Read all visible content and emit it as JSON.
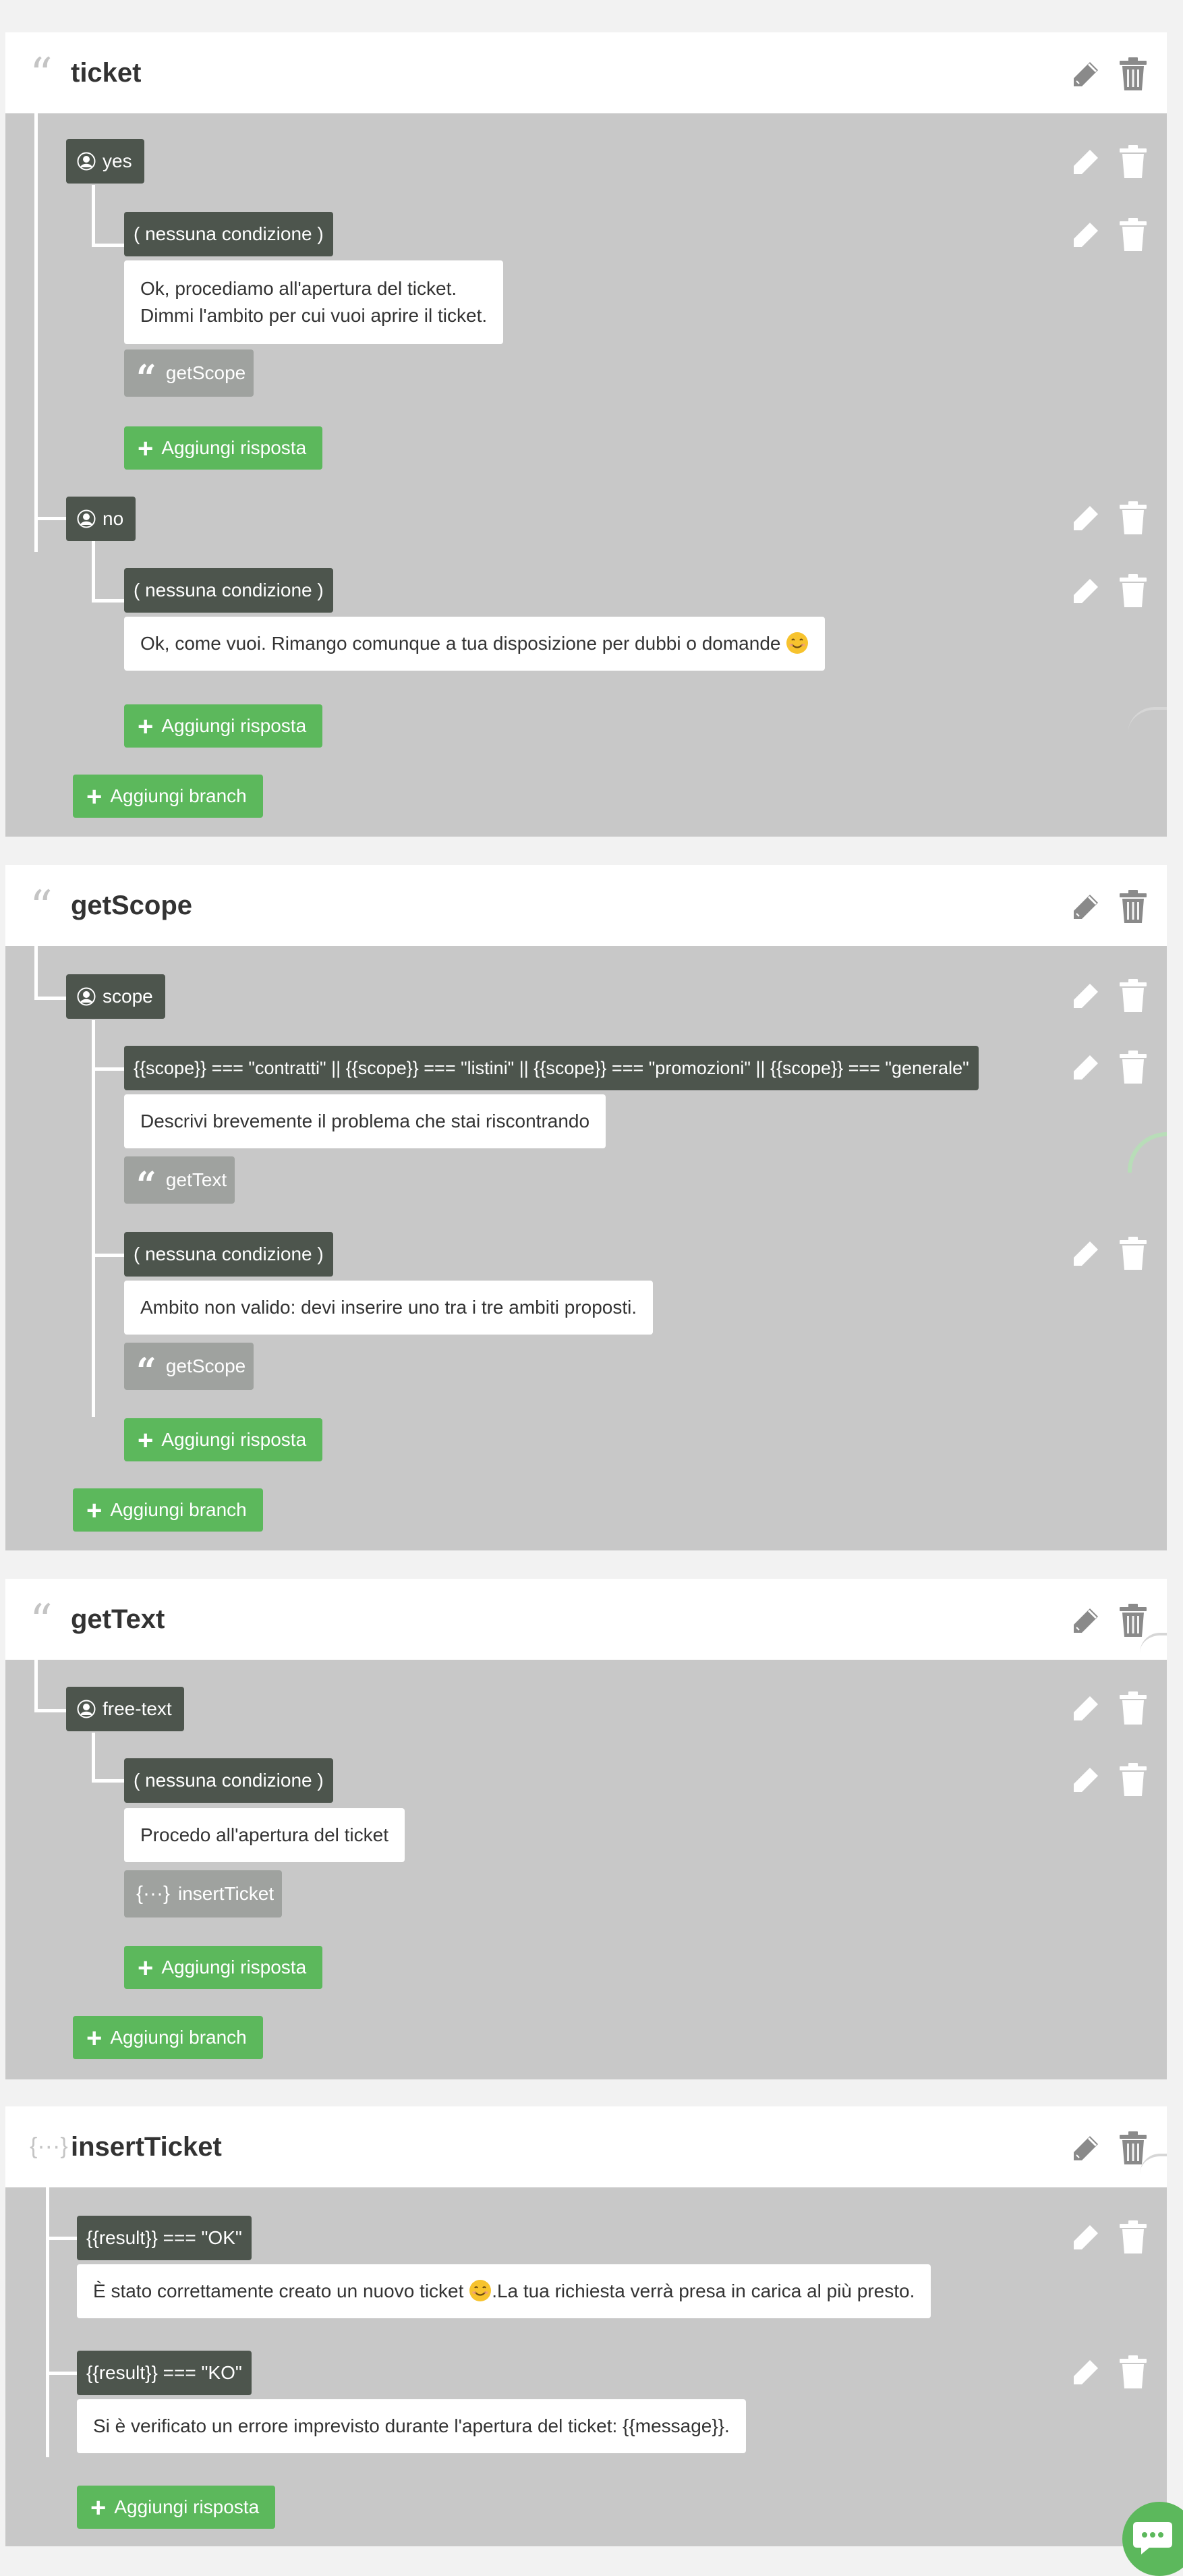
{
  "cards": {
    "ticket": {
      "title": "ticket",
      "icon": "quote-icon",
      "branches": {
        "yes": {
          "label": "yes",
          "cond": "( nessuna condizione )",
          "message": [
            "Ok, procediamo all'apertura del ticket.",
            "Dimmi l'ambito per cui vuoi aprire il ticket."
          ],
          "jump": "getScope",
          "add_reply": "Aggiungi risposta"
        },
        "no": {
          "label": "no",
          "cond": "( nessuna condizione )",
          "message": "Ok, come vuoi. Rimango comunque a tua disposizione per dubbi o domande",
          "add_reply": "Aggiungi risposta"
        }
      },
      "add_branch": "Aggiungi branch"
    },
    "getScope": {
      "title": "getScope",
      "icon": "quote-icon",
      "branch": {
        "label": "scope",
        "cond1": "{{scope}} === \"contratti\" || {{scope}} === \"listini\" || {{scope}} === \"promozioni\" || {{scope}} === \"generale\"",
        "message1": "Descrivi brevemente il problema che stai riscontrando",
        "jump1": "getText",
        "cond2": "( nessuna condizione )",
        "message2": "Ambito non valido: devi inserire uno tra i tre ambiti proposti.",
        "jump2": "getScope",
        "add_reply": "Aggiungi risposta"
      },
      "add_branch": "Aggiungi branch"
    },
    "getText": {
      "title": "getText",
      "icon": "quote-icon",
      "branch": {
        "label": "free-text",
        "cond": "( nessuna condizione )",
        "message": "Procedo all'apertura del ticket",
        "jump": "insertTicket",
        "add_reply": "Aggiungi risposta"
      },
      "add_branch": "Aggiungi branch"
    },
    "insertTicket": {
      "title": "insertTicket",
      "icon": "braces-icon",
      "cond1": "{{result}} === \"OK\"",
      "message1_a": "È stato correttamente creato un nuovo ticket",
      "message1_b": ".La tua richiesta verrà presa in carica al più presto.",
      "cond2": "{{result}} === \"KO\"",
      "message2": "Si è verificato un errore imprevisto durante l'apertura del ticket: {{message}}.",
      "add_reply": "Aggiungi risposta"
    }
  },
  "colors": {
    "page_bg": "#f2f2f2",
    "card_body": "#c8c8c8",
    "chip_dark": "#4d554d",
    "chip_gray": "#9fa29f",
    "accent_green": "#5cb85c"
  },
  "glyphs": {
    "quote": "“",
    "braces": "{···}",
    "plus": "+"
  }
}
